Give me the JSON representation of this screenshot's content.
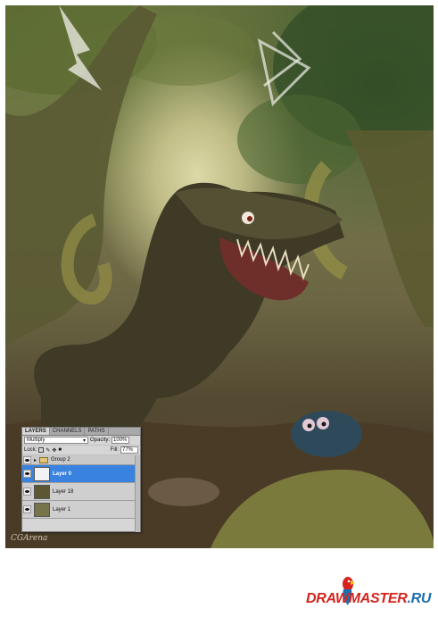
{
  "watermark": "CGArena",
  "brand": {
    "part1": "DRAW",
    "part2": "MASTER",
    "part3": ".RU"
  },
  "layers_panel": {
    "tabs": [
      "LAYERS",
      "CHANNELS",
      "PATHS"
    ],
    "blend_mode": "Multiply",
    "opacity_label": "Opacity:",
    "opacity_value": "100%",
    "lock_label": "Lock:",
    "fill_label": "Fill:",
    "fill_value": "77%",
    "layers": [
      {
        "name": "Group 2"
      },
      {
        "name": "Layer 0"
      },
      {
        "name": "Layer 18"
      },
      {
        "name": "Layer 1"
      }
    ]
  },
  "colors": {
    "selected": "#3a82e0",
    "brand_red": "#d5241e",
    "brand_blue": "#1b6fb0"
  }
}
